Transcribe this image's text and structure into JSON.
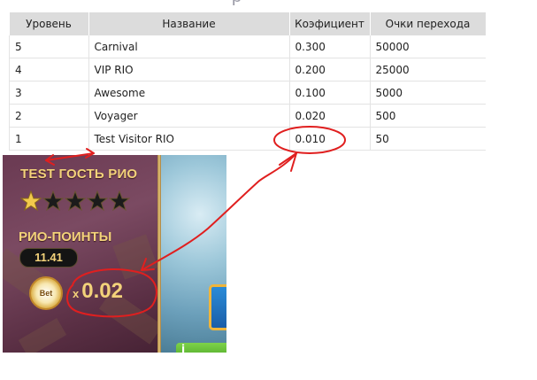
{
  "table": {
    "headers": [
      "Уровень",
      "Название",
      "Коэфициент",
      "Очки перехода"
    ],
    "rows": [
      {
        "level": "5",
        "name": "Carnival",
        "coef": "0.300",
        "points": "50000"
      },
      {
        "level": "4",
        "name": "VIP RIO",
        "coef": "0.200",
        "points": "25000"
      },
      {
        "level": "3",
        "name": "Awesome",
        "coef": "0.100",
        "points": "5000"
      },
      {
        "level": "2",
        "name": "Voyager",
        "coef": "0.020",
        "points": "500"
      },
      {
        "level": "1",
        "name": "Test Visitor RIO",
        "coef": "0.010",
        "points": "50"
      }
    ]
  },
  "game_panel": {
    "player_level_title": "TEST ГОСТЬ РИО",
    "stars_total": 5,
    "stars_filled": 1,
    "points_label": "РИО-ПОИНТЫ",
    "points_value": "11.41",
    "bet_coin_label": "Bet",
    "multiplier_prefix": "x",
    "multiplier_value": "0.02"
  },
  "annotation": {
    "color": "#e01f1f"
  }
}
